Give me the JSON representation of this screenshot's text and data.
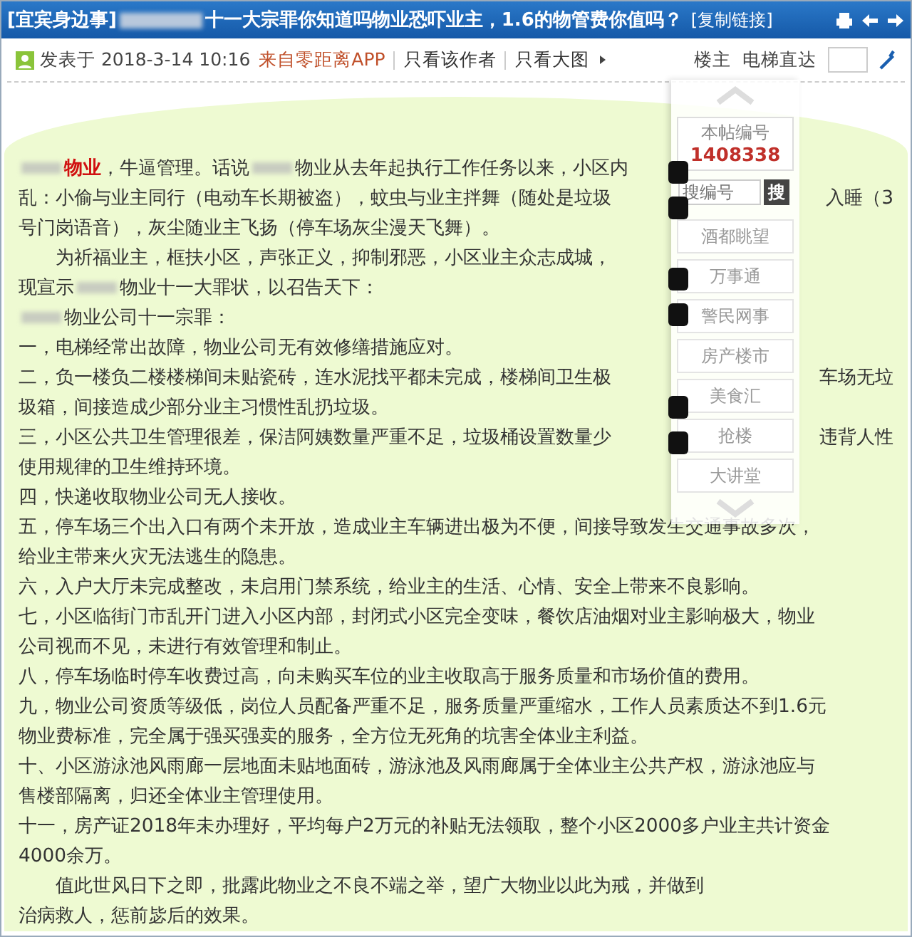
{
  "title_bar": {
    "category": "[宜宾身边事]",
    "title": "十一大宗罪你知道吗物业恐吓业主，1.6的物管费你值吗？",
    "copy_link": "[复制链接]"
  },
  "meta": {
    "posted": "发表于 2018-3-14 10:16",
    "source": "来自零距离APP",
    "links": [
      "只看该作者",
      "只看大图"
    ],
    "floor": "楼主",
    "jump_label": "电梯直达"
  },
  "side_panel": {
    "post_number_label": "本帖编号",
    "post_number": "1408338",
    "search_placeholder": "搜编号",
    "search_button": "搜",
    "items": [
      "酒都眺望",
      "万事通",
      "警民网事",
      "房产楼市",
      "美食汇",
      "抢楼",
      "大讲堂"
    ]
  },
  "lines": [
    {
      "left": [
        {
          "kind": "redacted"
        },
        {
          "kind": "highlight",
          "text": "物业"
        },
        {
          "kind": "text",
          "text": "，牛逼管理。话说"
        },
        {
          "kind": "redacted"
        },
        {
          "kind": "text",
          "text": "物业从去年起执行工作任务以来，小区内"
        }
      ]
    },
    {
      "left": [
        {
          "kind": "text",
          "text": "乱：小偷与业主同行（电动车长期被盗），蚊虫与业主拌舞（随处是垃圾"
        }
      ],
      "right": "入睡（3"
    },
    {
      "left": [
        {
          "kind": "text",
          "text": "号门岗语音），灰尘随业主飞扬（停车场灰尘漫天飞舞）。"
        }
      ]
    },
    {
      "left": [
        {
          "kind": "text",
          "text": "　　为祈福业主，框扶小区，声张正义，抑制邪恶，小区业主众志成城，"
        }
      ]
    },
    {
      "left": [
        {
          "kind": "text",
          "text": "现宣示"
        },
        {
          "kind": "redacted"
        },
        {
          "kind": "text",
          "text": "物业十一大罪状，以召告天下："
        }
      ]
    },
    {
      "left": [
        {
          "kind": "redacted"
        },
        {
          "kind": "text",
          "text": "物业公司十一宗罪："
        }
      ]
    },
    {
      "left": [
        {
          "kind": "text",
          "text": "一，电梯经常出故障，物业公司无有效修缮措施应对。"
        }
      ]
    },
    {
      "left": [
        {
          "kind": "text",
          "text": "二，负一楼负二楼楼梯间未贴瓷砖，连水泥找平都未完成，楼梯间卫生极"
        }
      ],
      "right": "车场无垃"
    },
    {
      "left": [
        {
          "kind": "text",
          "text": "圾箱，间接造成少部分业主习惯性乱扔垃圾。"
        }
      ]
    },
    {
      "left": [
        {
          "kind": "text",
          "text": "三，小区公共卫生管理很差，保洁阿姨数量严重不足，垃圾桶设置数量少"
        }
      ],
      "right": "违背人性"
    },
    {
      "left": [
        {
          "kind": "text",
          "text": "使用规律的卫生维持环境。"
        }
      ]
    },
    {
      "left": [
        {
          "kind": "text",
          "text": "四，快递收取物业公司无人接收。"
        }
      ]
    },
    {
      "left": [
        {
          "kind": "text",
          "text": "五，停车场三个出入口有两个未开放，造成业主车辆进出极为不便，间接导致发生交通事故多次，"
        }
      ]
    },
    {
      "left": [
        {
          "kind": "text",
          "text": "给业主带来火灾无法逃生的隐患。"
        }
      ]
    },
    {
      "left": [
        {
          "kind": "text",
          "text": "六，入户大厅未完成整改，未启用门禁系统，给业主的生活、心情、安全上带来不良影响。"
        }
      ]
    },
    {
      "left": [
        {
          "kind": "text",
          "text": "七，小区临街门市乱开门进入小区内部，封闭式小区完全变味，餐饮店油烟对业主影响极大，物业"
        }
      ]
    },
    {
      "left": [
        {
          "kind": "text",
          "text": "公司视而不见，未进行有效管理和制止。"
        }
      ]
    },
    {
      "left": [
        {
          "kind": "text",
          "text": "八，停车场临时停车收费过高，向未购买车位的业主收取高于服务质量和市场价值的费用。"
        }
      ]
    },
    {
      "left": [
        {
          "kind": "text",
          "text": "九，物业公司资质等级低，岗位人员配备严重不足，服务质量严重缩水，工作人员素质达不到1.6元"
        }
      ]
    },
    {
      "left": [
        {
          "kind": "text",
          "text": "物业费标准，完全属于强买强卖的服务，全方位无死角的坑害全体业主利益。"
        }
      ]
    },
    {
      "left": [
        {
          "kind": "text",
          "text": "十、小区游泳池风雨廊一层地面未贴地面砖，游泳池及风雨廊属于全体业主公共产权，游泳池应与"
        }
      ]
    },
    {
      "left": [
        {
          "kind": "text",
          "text": "售楼部隔离，归还全体业主管理使用。"
        }
      ]
    },
    {
      "left": [
        {
          "kind": "text",
          "text": "十一，房产证2018年未办理好，平均每户2万元的补贴无法领取，整个小区2000多户业主共计资金"
        }
      ]
    },
    {
      "left": [
        {
          "kind": "text",
          "text": "4000余万。"
        }
      ]
    },
    {
      "left": [
        {
          "kind": "text",
          "text": "　　值此世风日下之即，批露此物业之不良不端之举，望广大物业以此为戒，并做到"
        }
      ]
    },
    {
      "left": [
        {
          "kind": "text",
          "text": "治病救人，惩前毖后的效果。"
        }
      ]
    }
  ]
}
